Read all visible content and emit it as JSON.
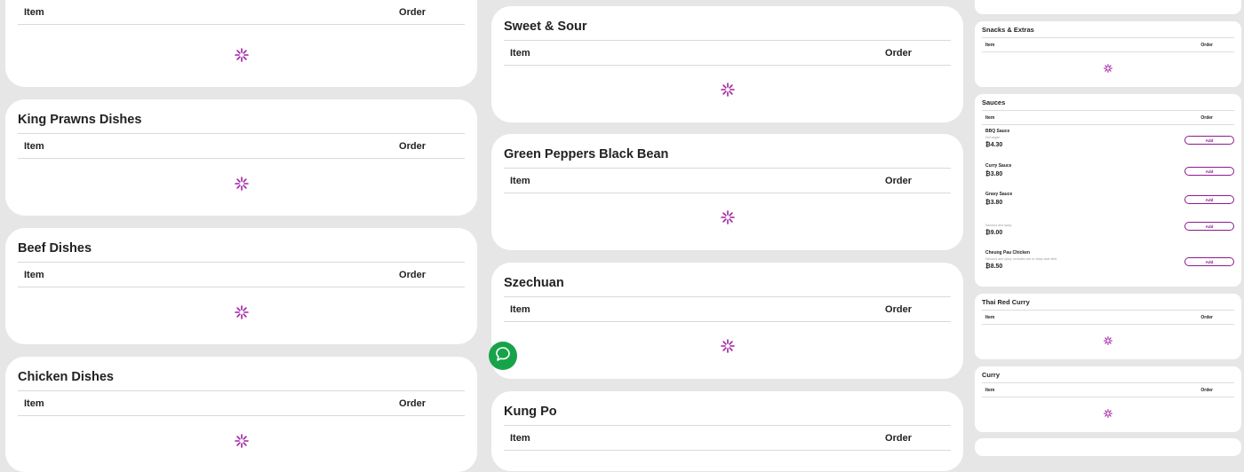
{
  "accent_color": "#a01ea0",
  "table_header": {
    "item": "Item",
    "order": "Order"
  },
  "left_column": [
    {
      "title": ""
    },
    {
      "title": "King Prawns Dishes"
    },
    {
      "title": "Beef Dishes"
    },
    {
      "title": "Chicken Dishes"
    }
  ],
  "middle_column": [
    {
      "title": "Sweet & Sour"
    },
    {
      "title": "Green Peppers Black Bean"
    },
    {
      "title": "Szechuan"
    },
    {
      "title": "Kung Po"
    }
  ],
  "right_column": {
    "snacks": {
      "title": "Snacks & Extras"
    },
    "sauces": {
      "title": "Sauces",
      "items": [
        {
          "name": "BBQ Sauce",
          "desc": "Hot vegan",
          "price": "₿4.30",
          "button": "Add"
        },
        {
          "name": "Curry Sauce",
          "desc": "",
          "price": "₿3.80",
          "button": "Add"
        },
        {
          "name": "Gravy Sauce",
          "desc": "",
          "price": "₿3.80",
          "button": "Add"
        },
        {
          "name": "",
          "desc": "Savoury and spicy",
          "price": "₿9.00",
          "button": "Add"
        },
        {
          "name": "Cheung Pau Chicken",
          "desc": "Savoury and spicy. Includes rice or chips side dish.",
          "price": "₿8.50",
          "button": "Add"
        }
      ]
    },
    "thai": {
      "title": "Thai Red Curry"
    },
    "curry": {
      "title": "Curry"
    }
  },
  "icons": {
    "loader": "spinner-icon",
    "fab": "chat-icon"
  }
}
